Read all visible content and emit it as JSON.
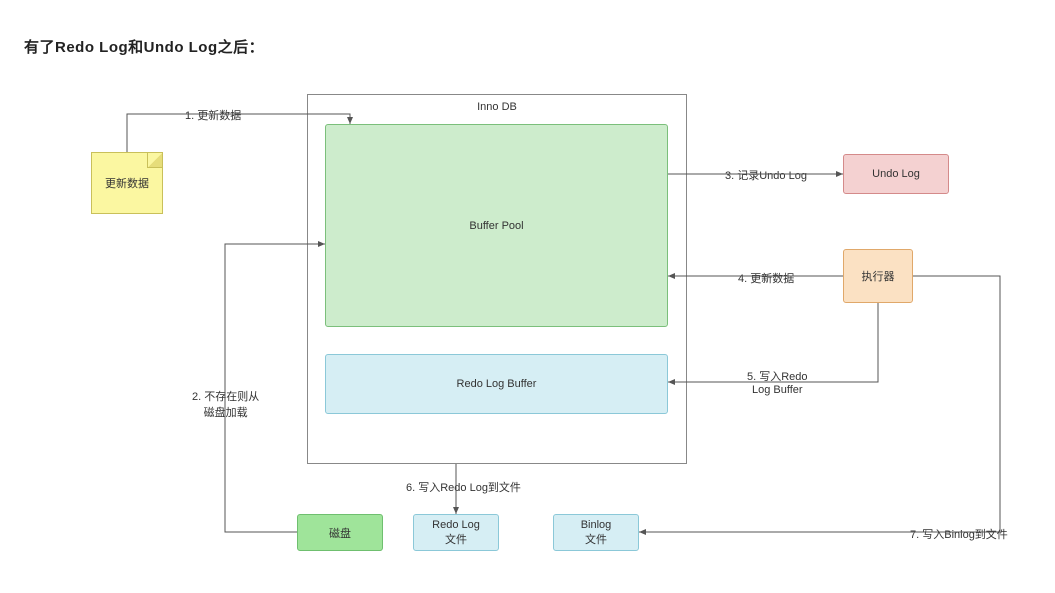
{
  "title": "有了Redo Log和Undo Log之后：",
  "note": "更新数据",
  "innodb": "Inno DB",
  "bufferpool": "Buffer Pool",
  "redobuf": "Redo Log Buffer",
  "undolog": "Undo Log",
  "executor": "执行器",
  "disk": "磁盘",
  "redofile": "Redo Log\n文件",
  "binlog": "Binlog\n文件",
  "edges": {
    "e1": "1. 更新数据",
    "e2": "2. 不存在则从\n磁盘加载",
    "e3": "3. 记录Undo Log",
    "e4": "4. 更新数据",
    "e5": "5. 写入Redo\nLog Buffer",
    "e6": "6. 写入Redo Log到文件",
    "e7": "7. 写入Binlog到文件"
  }
}
